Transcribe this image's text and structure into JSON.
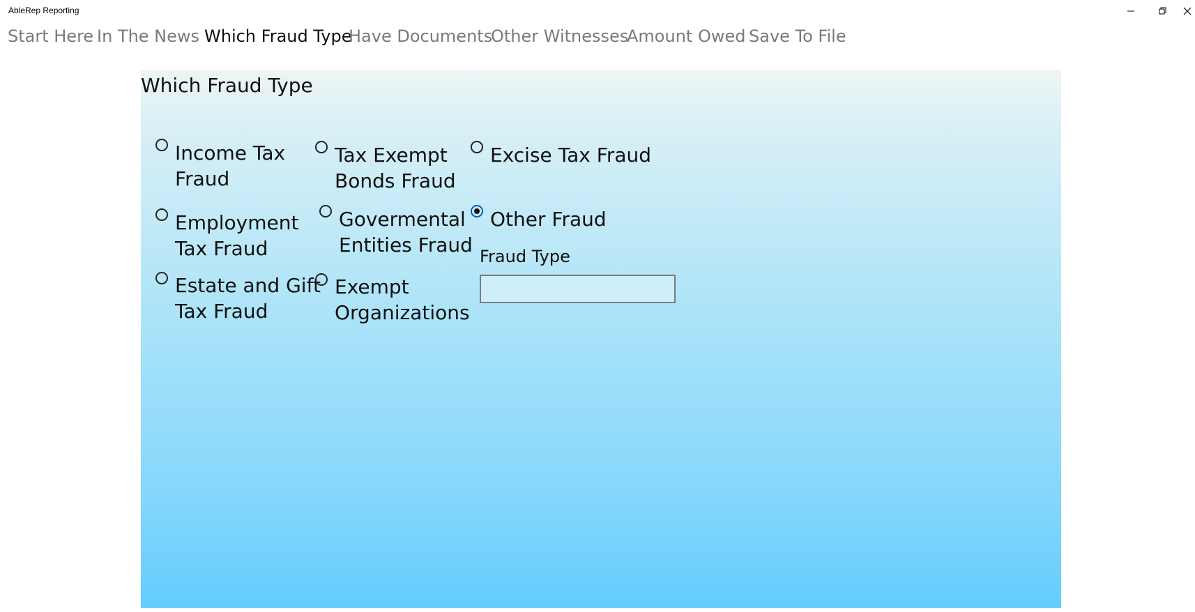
{
  "window": {
    "title": "AbleRep Reporting",
    "controls": {
      "minimize": "minimize-icon",
      "restore": "restore-icon",
      "close": "close-icon"
    }
  },
  "nav": {
    "tabs": [
      {
        "label": "Start Here",
        "active": false
      },
      {
        "label": "In The News",
        "active": false
      },
      {
        "label": "Which Fraud Type",
        "active": true
      },
      {
        "label": "Have Documents",
        "active": false
      },
      {
        "label": "Other Witnesses",
        "active": false
      },
      {
        "label": "Amount Owed",
        "active": false
      },
      {
        "label": "Save To File",
        "active": false
      }
    ]
  },
  "panel": {
    "title": "Which Fraud Type",
    "options": [
      {
        "line1": "Income Tax",
        "line2": "Fraud",
        "checked": false
      },
      {
        "line1": "Tax Exempt",
        "line2": "Bonds Fraud",
        "checked": false
      },
      {
        "line1": "Excise Tax Fraud",
        "line2": "",
        "checked": false
      },
      {
        "line1": "Employment",
        "line2": "Tax Fraud",
        "checked": false
      },
      {
        "line1": "Govermental",
        "line2": "Entities Fraud",
        "checked": false
      },
      {
        "line1": "Other Fraud",
        "line2": "",
        "checked": true
      },
      {
        "line1": "Estate and Gift",
        "line2": "Tax Fraud",
        "checked": false
      },
      {
        "line1": "Exempt",
        "line2": "Organizations",
        "checked": false
      }
    ],
    "fraud_type": {
      "label": "Fraud Type",
      "value": "",
      "placeholder": ""
    }
  },
  "colors": {
    "panel_top": "#eef5f5",
    "panel_bottom": "#63cdfd",
    "radio_checked_ring": "#0f5fa8",
    "nav_inactive": "#7a7a7a"
  }
}
